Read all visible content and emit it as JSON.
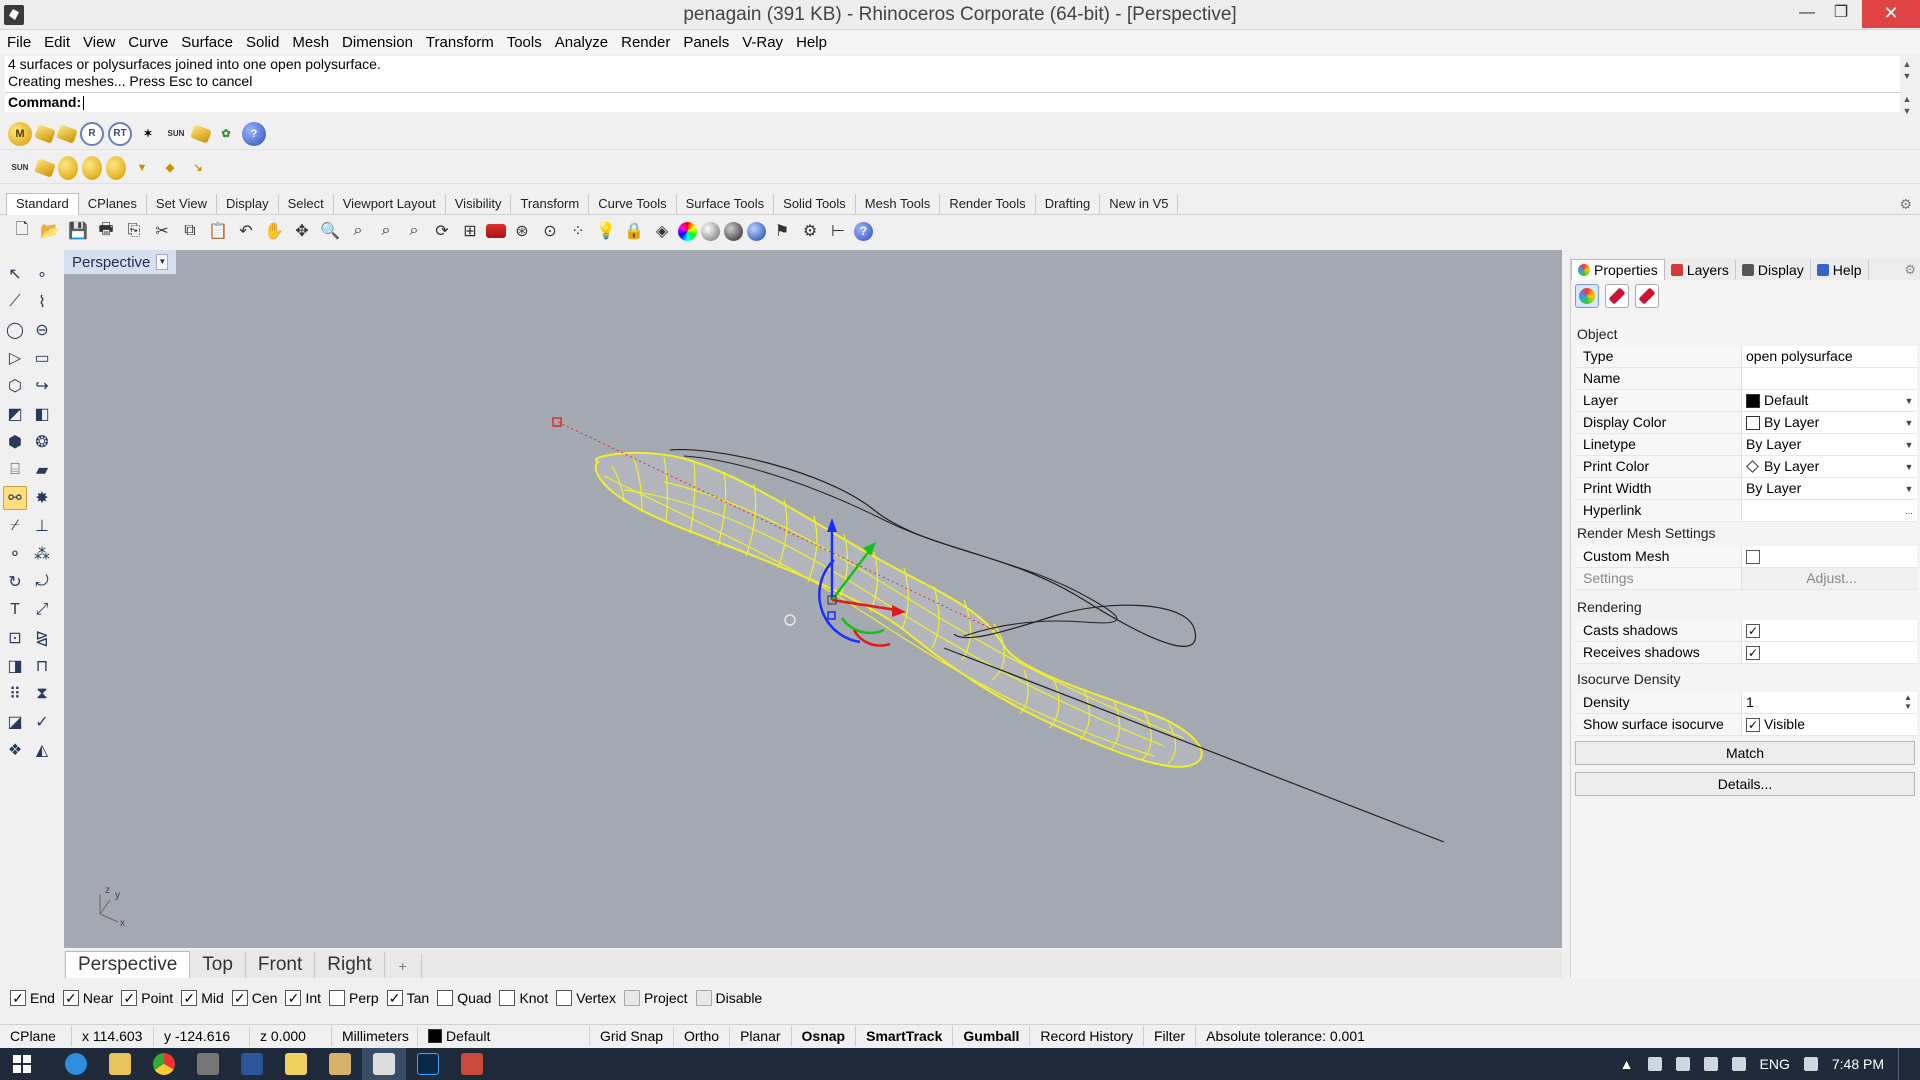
{
  "window": {
    "title": "penagain (391 KB) - Rhinoceros Corporate (64-bit) - [Perspective]",
    "minimize": "—",
    "maximize": "❐",
    "close": "✕"
  },
  "menu": [
    "File",
    "Edit",
    "View",
    "Curve",
    "Surface",
    "Solid",
    "Mesh",
    "Dimension",
    "Transform",
    "Tools",
    "Analyze",
    "Render",
    "Panels",
    "V-Ray",
    "Help"
  ],
  "command": {
    "history": [
      "4 surfaces or polysurfaces joined into one open polysurface.",
      "Creating meshes... Press Esc to cancel"
    ],
    "prompt": "Command:",
    "value": ""
  },
  "toolbar_tabs": [
    "Standard",
    "CPlanes",
    "Set View",
    "Display",
    "Select",
    "Viewport Layout",
    "Visibility",
    "Transform",
    "Curve Tools",
    "Surface Tools",
    "Solid Tools",
    "Mesh Tools",
    "Render Tools",
    "Drafting",
    "New in V5"
  ],
  "active_toolbar_tab": "Standard",
  "viewport": {
    "name": "Perspective",
    "axis_z": "z",
    "axis_y": "y",
    "axis_x": "x",
    "background": "#a4a8b0",
    "curve_color": "#f0ef2a"
  },
  "viewport_tabs": [
    "Perspective",
    "Top",
    "Front",
    "Right"
  ],
  "viewport_add": "+",
  "panel": {
    "tabs": [
      "Properties",
      "Layers",
      "Display",
      "Help"
    ],
    "section_object": "Object",
    "rows": [
      {
        "label": "Type",
        "value": "open polysurface"
      },
      {
        "label": "Name",
        "value": ""
      },
      {
        "label": "Layer",
        "value": "Default"
      },
      {
        "label": "Display Color",
        "value": "By Layer"
      },
      {
        "label": "Linetype",
        "value": "By Layer"
      },
      {
        "label": "Print Color",
        "value": "By Layer"
      },
      {
        "label": "Print Width",
        "value": "By Layer"
      },
      {
        "label": "Hyperlink",
        "value": "",
        "button": "..."
      }
    ],
    "section_mesh": "Render Mesh Settings",
    "custom_mesh": "Custom Mesh",
    "settings": "Settings",
    "adjust": "Adjust...",
    "section_rendering": "Rendering",
    "casts_shadows": "Casts shadows",
    "receives_shadows": "Receives shadows",
    "section_isocurve": "Isocurve Density",
    "density_label": "Density",
    "density_value": "1",
    "show_isocurve": "Show surface isocurve",
    "visible": "Visible",
    "match": "Match",
    "details": "Details..."
  },
  "osnaps": [
    {
      "label": "End",
      "checked": true
    },
    {
      "label": "Near",
      "checked": true
    },
    {
      "label": "Point",
      "checked": true
    },
    {
      "label": "Mid",
      "checked": true
    },
    {
      "label": "Cen",
      "checked": true
    },
    {
      "label": "Int",
      "checked": true
    },
    {
      "label": "Perp",
      "checked": false
    },
    {
      "label": "Tan",
      "checked": true
    },
    {
      "label": "Quad",
      "checked": false
    },
    {
      "label": "Knot",
      "checked": false
    },
    {
      "label": "Vertex",
      "checked": false
    },
    {
      "label": "Project",
      "checked": false
    },
    {
      "label": "Disable",
      "checked": false
    }
  ],
  "status": {
    "cplane": "CPlane",
    "x": "x 114.603",
    "y": "y -124.616",
    "z": "z 0.000",
    "units": "Millimeters",
    "layer": "Default",
    "grid_snap": "Grid Snap",
    "ortho": "Ortho",
    "planar": "Planar",
    "osnap": "Osnap",
    "smarttrack": "SmartTrack",
    "gumball": "Gumball",
    "record_history": "Record History",
    "filter": "Filter",
    "tolerance": "Absolute tolerance: 0.001"
  },
  "taskbar": {
    "language": "ENG",
    "time": "7:48 PM"
  }
}
